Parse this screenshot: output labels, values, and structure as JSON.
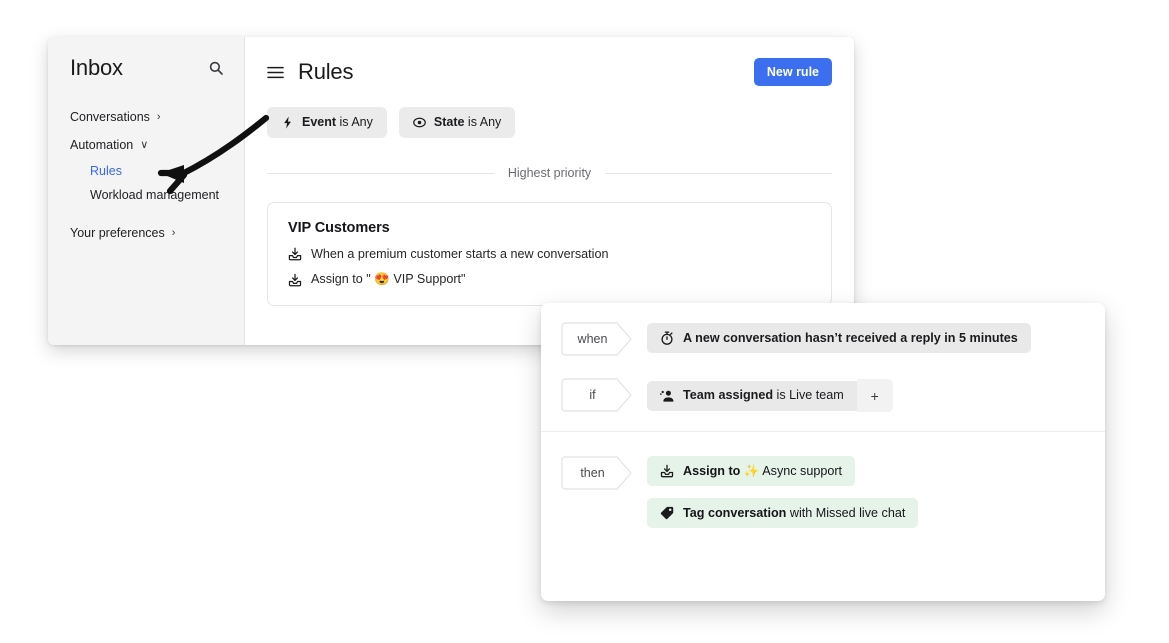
{
  "sidebar": {
    "title": "Inbox",
    "search_icon": "search-icon",
    "items": [
      {
        "label": "Conversations",
        "caret": "›",
        "active": false,
        "sub": false
      },
      {
        "label": "Automation",
        "caret": "∨",
        "active": false,
        "sub": false
      },
      {
        "label": "Rules",
        "caret": "",
        "active": true,
        "sub": true
      },
      {
        "label": "Workload management",
        "caret": "",
        "active": false,
        "sub": true
      },
      {
        "label": "Your preferences",
        "caret": "›",
        "active": false,
        "sub": false
      }
    ]
  },
  "header": {
    "menu_icon": "hamburger-icon",
    "title": "Rules",
    "new_rule_label": "New rule"
  },
  "filters": [
    {
      "icon": "lightning-bolt-icon",
      "bold": "Event",
      "rest": " is Any"
    },
    {
      "icon": "circle-dot-icon",
      "bold": "State",
      "rest": " is Any"
    }
  ],
  "divider": {
    "label": "Highest priority"
  },
  "rule_card": {
    "title": "VIP Customers",
    "lines": [
      {
        "icon": "inbox-arrow-icon",
        "text": "When a premium customer starts a new conversation",
        "emoji": ""
      },
      {
        "icon": "assign-arrow-icon",
        "prefix": "Assign to \" ",
        "emoji": "😍",
        "suffix": " VIP Support\""
      }
    ]
  },
  "editor": {
    "when": {
      "tag": "when",
      "token": {
        "icon": "stopwatch-icon",
        "bold": "A new conversation hasn’t received a reply in 5 minutes",
        "rest": ""
      }
    },
    "if": {
      "tag": "if",
      "token": {
        "icon": "team-icon",
        "bold": "Team assigned",
        "rest": " is Live team"
      },
      "add_label": "+"
    },
    "then": {
      "tag": "then",
      "tokens": [
        {
          "icon": "assign-arrow-icon",
          "bold": "Assign to ",
          "emoji": "✨",
          "rest": " Async support"
        },
        {
          "icon": "tag-icon",
          "bold": "Tag conversation",
          "emoji": "",
          "rest": " with Missed live chat"
        }
      ]
    }
  },
  "colors": {
    "accent_blue": "#3B6FF0",
    "link_blue": "#3767ef",
    "sidebar_bg": "#f4f4f5",
    "chip_grey": "#e9e9ea",
    "chip_green": "#e6f3e8",
    "emoji_orange": "#f0962a"
  },
  "annotation": {
    "type": "curved-arrow",
    "points_to": "Rules"
  }
}
